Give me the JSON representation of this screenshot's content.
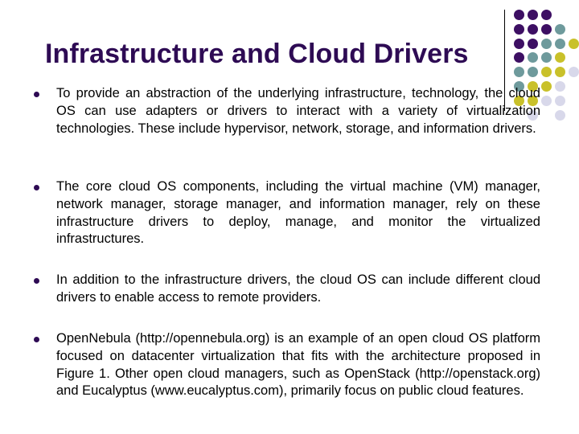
{
  "slide": {
    "title": "Infrastructure and Cloud Drivers",
    "bullets": [
      {
        "text": "To provide an abstraction of the underlying infrastructure, technology, the cloud OS can use adapters or drivers to interact with a variety of virtualization technologies. These include hypervisor, network, storage, and information drivers."
      },
      {
        "text": "The core cloud OS components, including the virtual machine (VM) manager, network manager, storage manager, and information manager, rely on these infrastructure drivers to deploy, manage, and monitor the virtualized infrastructures."
      },
      {
        "text": "In addition to the infrastructure drivers, the cloud OS can include different cloud drivers to enable access to remote providers."
      },
      {
        "text": "OpenNebula (http://opennebula.org) is an example of an open cloud OS platform focused on datacenter virtualization that fits with the architecture proposed in Figure 1. Other open cloud managers, such as OpenStack (http://openstack.org) and Eucalyptus  (www.eucalyptus.com), primarily focus on public cloud features."
      }
    ]
  },
  "decoration": {
    "colors": {
      "D": "#3d0f63",
      "T": "#6e9a9c",
      "Y": "#c9c12a",
      "L": "#d8d8ea"
    },
    "grid": [
      "DDD__",
      "DDDT_",
      "DDTTY",
      "DTTY_",
      "TTYYL",
      "TYYL_",
      "YYLL_",
      "_L_L_"
    ]
  }
}
